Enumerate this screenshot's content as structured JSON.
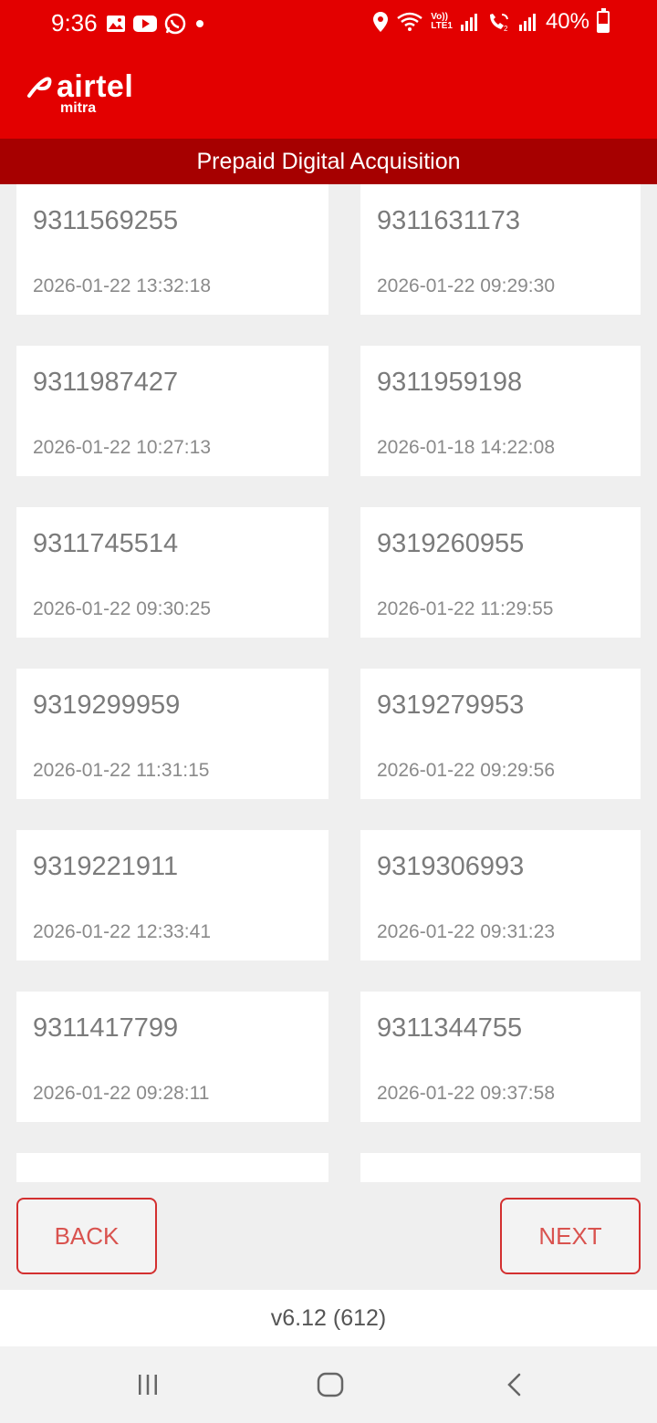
{
  "status_bar": {
    "time": "9:36",
    "battery": "40%",
    "battery_level": 0.4,
    "icons_left": [
      "gallery-icon",
      "youtube-icon",
      "whatsapp-icon",
      "dot-icon"
    ],
    "icons_right": [
      "location-icon",
      "wifi-icon",
      "volte-icon",
      "signal-icon",
      "wifi-calling-icon",
      "signal-icon"
    ],
    "volte_label": "Vo))",
    "lte_label": "LTE1"
  },
  "header": {
    "brand": "airtel",
    "brand_sub": "mitra",
    "title": "Prepaid Digital Acquisition"
  },
  "entries": [
    {
      "number": "9311569255",
      "timestamp": "2026-01-22 13:32:18"
    },
    {
      "number": "9311631173",
      "timestamp": "2026-01-22 09:29:30"
    },
    {
      "number": "9311987427",
      "timestamp": "2026-01-22 10:27:13"
    },
    {
      "number": "9311959198",
      "timestamp": "2026-01-18 14:22:08"
    },
    {
      "number": "9311745514",
      "timestamp": "2026-01-22 09:30:25"
    },
    {
      "number": "9319260955",
      "timestamp": "2026-01-22 11:29:55"
    },
    {
      "number": "9319299959",
      "timestamp": "2026-01-22 11:31:15"
    },
    {
      "number": "9319279953",
      "timestamp": "2026-01-22 09:29:56"
    },
    {
      "number": "9319221911",
      "timestamp": "2026-01-22 12:33:41"
    },
    {
      "number": "9319306993",
      "timestamp": "2026-01-22 09:31:23"
    },
    {
      "number": "9311417799",
      "timestamp": "2026-01-22 09:28:11"
    },
    {
      "number": "9311344755",
      "timestamp": "2026-01-22 09:37:58"
    },
    {
      "number": "",
      "timestamp": ""
    },
    {
      "number": "",
      "timestamp": ""
    }
  ],
  "buttons": {
    "back": "BACK",
    "next": "NEXT"
  },
  "version": "v6.12 (612)",
  "nav": [
    "recents-icon",
    "home-icon",
    "back-icon"
  ],
  "colors": {
    "brand_red": "#e30000",
    "subheader_red": "#a60000",
    "button_border": "#d32f2f",
    "button_text": "#d9534f"
  }
}
